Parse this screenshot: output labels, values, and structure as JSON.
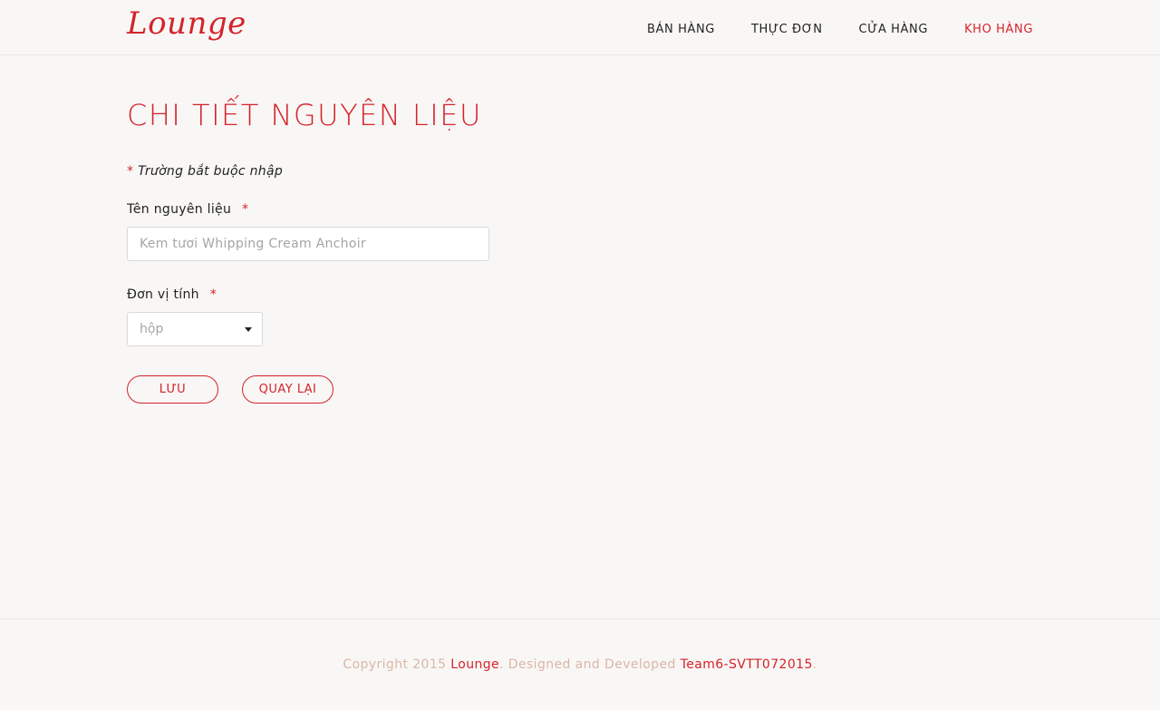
{
  "brand": {
    "logo_text": "Lounge"
  },
  "nav": {
    "items": [
      {
        "label": "BÁN HÀNG",
        "active": false
      },
      {
        "label": "THỰC ĐƠN",
        "active": false
      },
      {
        "label": "CỬA HÀNG",
        "active": false
      },
      {
        "label": "KHO HÀNG",
        "active": true
      }
    ]
  },
  "page": {
    "title": "CHI TIẾT NGUYÊN LIỆU"
  },
  "form": {
    "required_star": "*",
    "required_note": "Trường bắt buộc nhập",
    "name_field": {
      "label": "Tên nguyên liệu",
      "placeholder": "Kem tươi Whipping Cream Anchoir"
    },
    "unit_field": {
      "label": "Đơn vị tính",
      "selected": "hộp"
    },
    "save_label": "LƯU",
    "back_label": "QUAY LẠI"
  },
  "footer": {
    "prefix": "Copyright 2015 ",
    "brand_link": "Lounge",
    "middle": ". Designed and Developed ",
    "team_link": "Team6-SVTT072015",
    "suffix": "."
  },
  "colors": {
    "accent": "#d4232b",
    "background": "#f9f7f5",
    "footer_text": "#d9b7a7"
  }
}
